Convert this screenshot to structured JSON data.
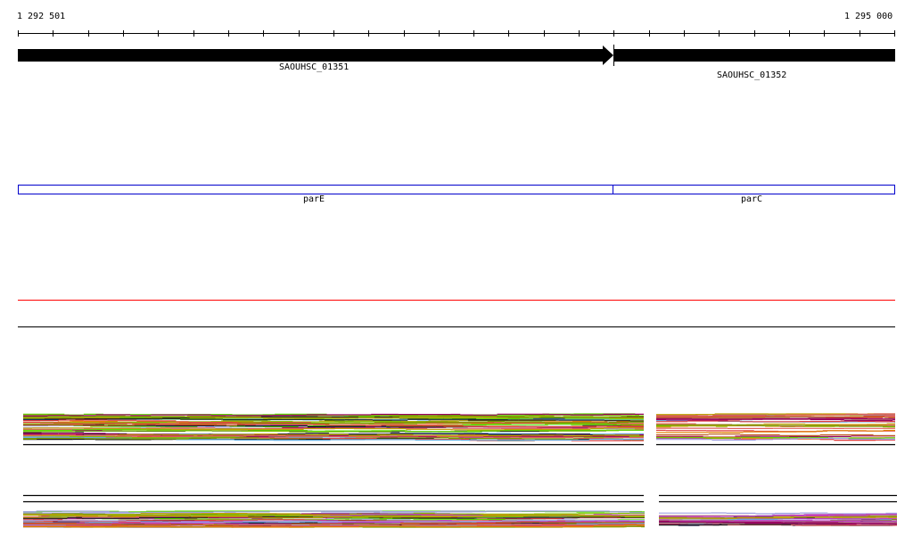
{
  "ruler": {
    "start_label": "1 292 501",
    "end_label": "1 295 000",
    "tick_count": 26
  },
  "genes": [
    {
      "name": "SAOUHSC_01351",
      "strand": "+"
    },
    {
      "name": "SAOUHSC_01352",
      "strand": "+"
    }
  ],
  "features": [
    {
      "name": "parE",
      "color": "#0000cc"
    },
    {
      "name": "parC",
      "color": "#0000cc"
    }
  ],
  "colors": {
    "threshold_line": "#ff0000",
    "baseline": "#000000",
    "palette": [
      "#7a9a00",
      "#5ad800",
      "#e08000",
      "#c06020",
      "#9a0060",
      "#000033",
      "#e04040",
      "#b08080",
      "#6ab0e0",
      "#a0a0e0",
      "#c040c0",
      "#80c000",
      "#c0a000",
      "#e06060",
      "#202020"
    ]
  }
}
